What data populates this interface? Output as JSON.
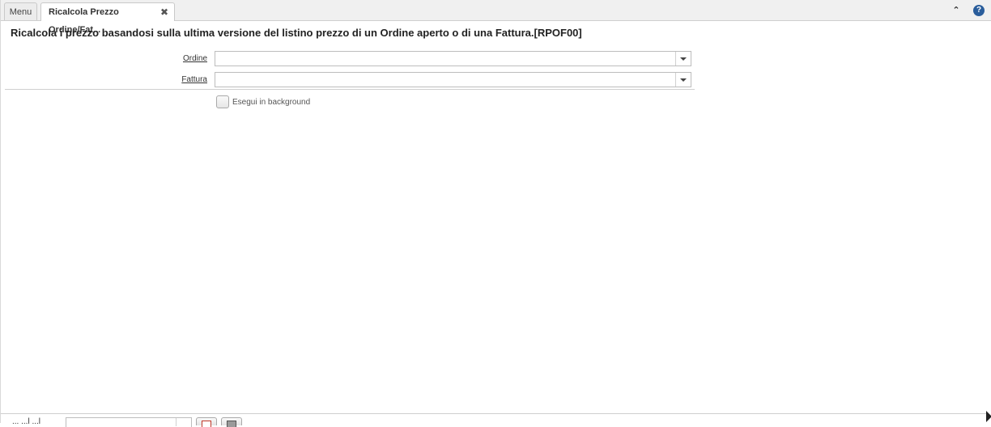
{
  "tabs": {
    "menu_label": "Menu",
    "active_label": "Ricalcola Prezzo Ordine/Fat...",
    "close_glyph": "✖"
  },
  "toolbar": {
    "collapse_icon": "chevrons-up-icon",
    "collapse_glyph": "⌃",
    "help_icon": "help-icon",
    "help_glyph": "?"
  },
  "page": {
    "title": "Ricalcola i prezzo basandosi sulla ultima versione del listino prezzo di un Ordine aperto o di una Fattura.[RPOF00]"
  },
  "form": {
    "ordine": {
      "label": "Ordine",
      "value": ""
    },
    "fattura": {
      "label": "Fattura",
      "value": ""
    },
    "background": {
      "label": "Esegui in background",
      "checked": false
    }
  },
  "bottom": {
    "label": "... ...l ...l",
    "value": ""
  },
  "colors": {
    "help_bg": "#2a5d9b",
    "tabbar_bg": "#f0f0f0",
    "border": "#bdbdbd"
  }
}
